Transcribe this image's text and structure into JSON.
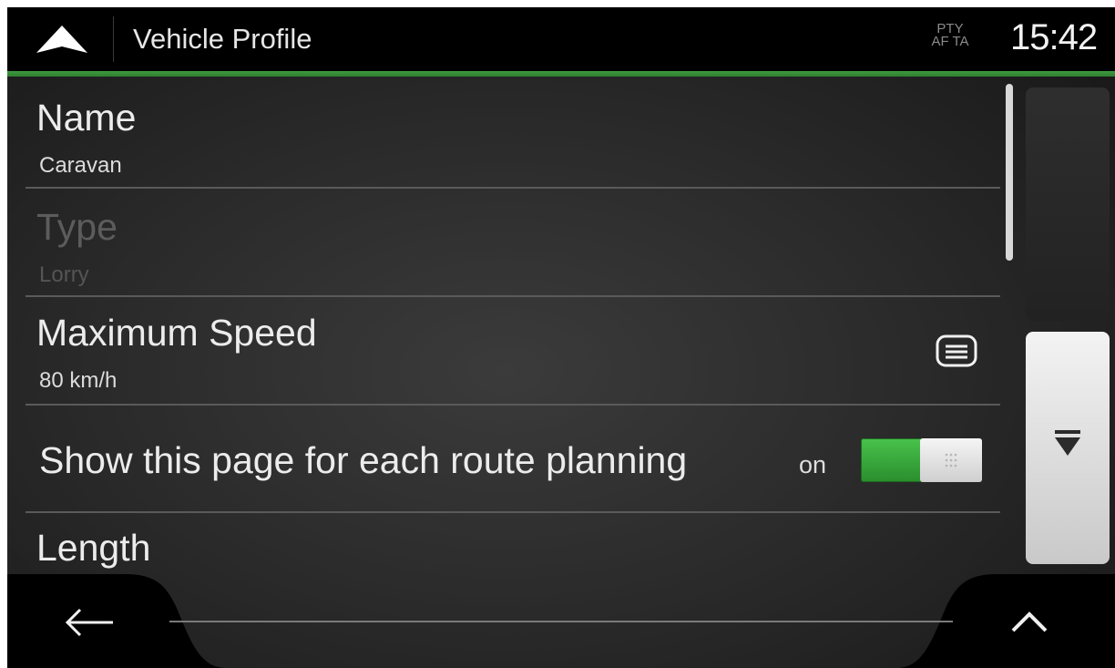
{
  "header": {
    "title": "Vehicle Profile",
    "traffic_line1": "PTY",
    "traffic_line2": "AF TA",
    "clock": "15:42",
    "accent_color": "#3e9a3e"
  },
  "list": {
    "name": {
      "label": "Name",
      "value": "Caravan"
    },
    "type": {
      "label": "Type",
      "value": "Lorry",
      "enabled": false
    },
    "max_speed": {
      "label": "Maximum Speed",
      "value": "80 km/h",
      "icon": "list-icon"
    },
    "show_page": {
      "label": "Show this page for each route planning",
      "state": "on",
      "checked": true
    },
    "length": {
      "label": "Length"
    }
  },
  "icons": {
    "header": "navigation-arrow-icon",
    "scroll_down": "scroll-down-icon",
    "back": "back-arrow-icon",
    "up": "chevron-up-icon"
  }
}
